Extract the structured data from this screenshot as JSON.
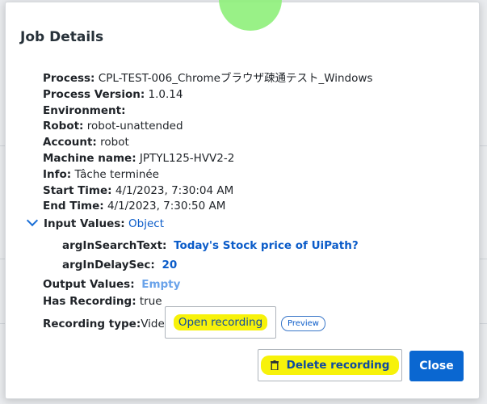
{
  "dialog": {
    "title": "Job Details",
    "details": [
      {
        "label": "Process:",
        "value": "CPL-TEST-006_Chromeブラウザ疎通テスト_Windows"
      },
      {
        "label": "Process Version:",
        "value": "1.0.14"
      },
      {
        "label": "Environment:",
        "value": ""
      },
      {
        "label": "Robot:",
        "value": "robot-unattended"
      },
      {
        "label": "Account:",
        "value": "robot"
      },
      {
        "label": "Machine name:",
        "value": "JPTYL125-HVV2-2"
      },
      {
        "label": "Info:",
        "value": "Tâche terminée"
      },
      {
        "label": "Start Time:",
        "value": "4/1/2023, 7:30:04 AM"
      },
      {
        "label": "End Time:",
        "value": "4/1/2023, 7:30:50 AM"
      }
    ],
    "input_values": {
      "label": "Input Values:",
      "value": "Object",
      "args": [
        {
          "name": "argInSearchText:",
          "value": "Today's Stock price of UiPath?"
        },
        {
          "name": "argInDelaySec:",
          "value": "20"
        }
      ]
    },
    "output_values": {
      "label": "Output Values:",
      "value": "Empty"
    },
    "has_recording": {
      "label": "Has Recording:",
      "value": "true"
    },
    "recording_type": {
      "label": "Recording type:",
      "value": "Video"
    },
    "buttons": {
      "open_recording": "Open recording",
      "preview": "Preview",
      "delete_recording": "Delete recording",
      "close": "Close"
    }
  },
  "colors": {
    "accent": "#0a67d1",
    "highlight": "#f7f20a",
    "link": "#0b5cc9"
  },
  "icons": {
    "expand": "chevron-down-icon",
    "delete": "trash-icon"
  }
}
